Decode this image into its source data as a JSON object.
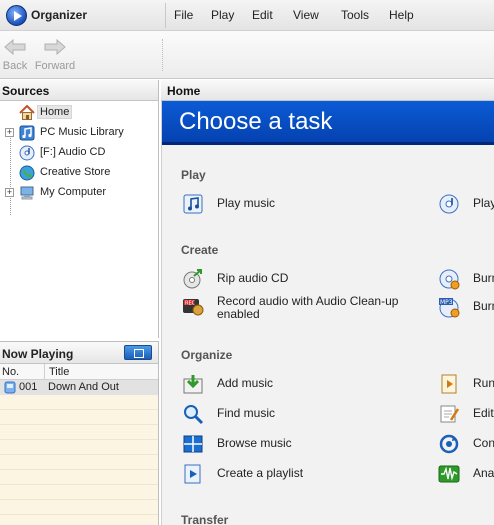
{
  "app": {
    "title": "Organizer"
  },
  "menu": [
    "File",
    "Play",
    "Edit",
    "View",
    "Tools",
    "Help"
  ],
  "toolbar": {
    "back_label": "Back",
    "forward_label": "Forward"
  },
  "sources": {
    "header": "Sources",
    "items": [
      {
        "label": "Home",
        "icon": "home-icon",
        "selected": true,
        "expander": false
      },
      {
        "label": "PC Music Library",
        "icon": "music-library-icon",
        "expander": true
      },
      {
        "label": "[F:] Audio CD",
        "icon": "audio-cd-icon",
        "expander": false
      },
      {
        "label": "Creative Store",
        "icon": "globe-icon",
        "expander": false
      },
      {
        "label": "My Computer",
        "icon": "computer-icon",
        "expander": true
      }
    ]
  },
  "now_playing": {
    "header": "Now Playing",
    "columns": {
      "no": "No.",
      "title": "Title"
    },
    "rows": [
      {
        "no": "001",
        "title": "Down And Out"
      }
    ]
  },
  "main": {
    "breadcrumb": "Home",
    "banner_title": "Choose a task",
    "sections": [
      {
        "title": "Play",
        "tasks_left": [
          "Play music"
        ],
        "tasks_right": [
          "Play"
        ]
      },
      {
        "title": "Create",
        "tasks_left": [
          "Rip audio CD",
          "Record audio with Audio Clean-up enabled"
        ],
        "tasks_right": [
          "Burn",
          "Burn"
        ]
      },
      {
        "title": "Organize",
        "tasks_left": [
          "Add music",
          "Find music",
          "Browse music",
          "Create a playlist"
        ],
        "tasks_right": [
          "Run",
          "Edit",
          "Conv",
          "Anal"
        ]
      },
      {
        "title": "Transfer"
      }
    ]
  },
  "colors": {
    "banner": "#0542b0",
    "accent": "#1a5fb8",
    "now_playing_bg": "#fdf5e4"
  }
}
